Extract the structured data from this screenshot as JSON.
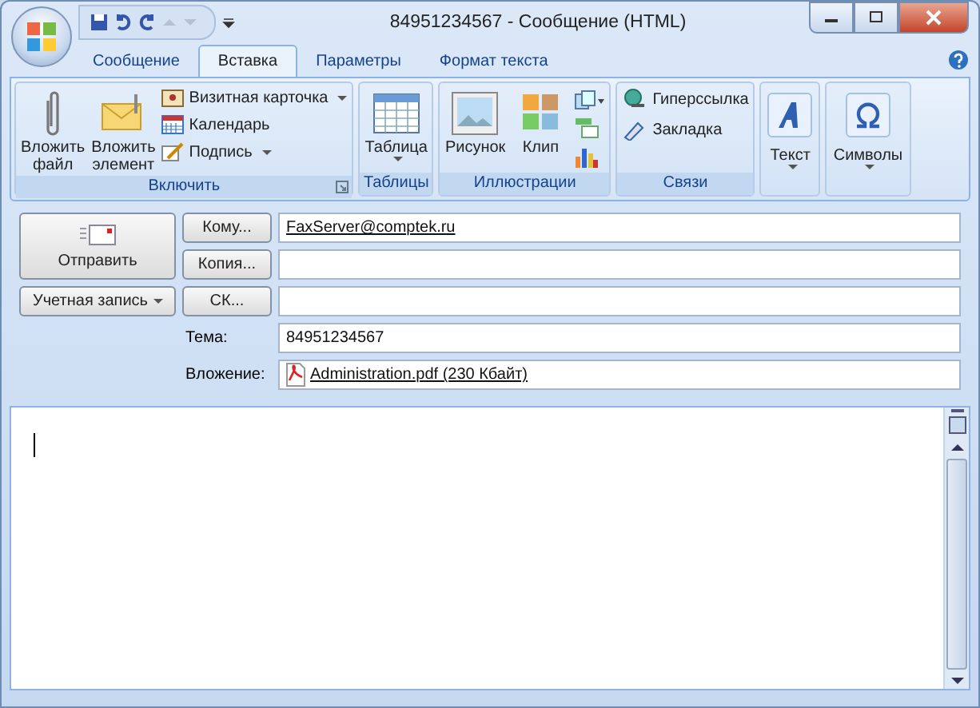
{
  "window": {
    "title": "84951234567 - Сообщение (HTML)"
  },
  "tabs": [
    {
      "label": "Сообщение",
      "selected": false
    },
    {
      "label": "Вставка",
      "selected": true
    },
    {
      "label": "Параметры",
      "selected": false
    },
    {
      "label": "Формат текста",
      "selected": false
    }
  ],
  "ribbon_groups": [
    {
      "title": "Включить",
      "launcher": true,
      "items": [
        {
          "kind": "large",
          "label": "Вложить файл"
        },
        {
          "kind": "large",
          "label": "Вложить элемент"
        },
        {
          "kind": "stack",
          "items": [
            {
              "label": "Визитная карточка",
              "dropdown": true
            },
            {
              "label": "Календарь"
            },
            {
              "label": "Подпись",
              "dropdown": true
            }
          ]
        }
      ]
    },
    {
      "title": "Таблицы",
      "items": [
        {
          "kind": "large",
          "label": "Таблица",
          "dropdown": true
        }
      ]
    },
    {
      "title": "Иллюстрации",
      "items": [
        {
          "kind": "large",
          "label": "Рисунок"
        },
        {
          "kind": "large",
          "label": "Клип"
        },
        {
          "kind": "iconstack"
        }
      ]
    },
    {
      "title": "Связи",
      "items": [
        {
          "kind": "stack",
          "items": [
            {
              "label": "Гиперссылка"
            },
            {
              "label": "Закладка"
            }
          ]
        }
      ]
    },
    {
      "items": [
        {
          "kind": "boxed",
          "label": "Текст",
          "dropdown": true
        }
      ]
    },
    {
      "items": [
        {
          "kind": "boxed",
          "label": "Символы",
          "dropdown": true
        }
      ]
    }
  ],
  "form": {
    "send_button": "Отправить",
    "account_button": {
      "label": "Учетная запись",
      "dropdown": true
    },
    "address_rows": [
      {
        "button": "Кому...",
        "value": "FaxServer@comptek.ru"
      },
      {
        "button": "Копия..."
      },
      {
        "button": "СК..."
      }
    ],
    "subject": {
      "label": "Тема:",
      "value": "84951234567"
    },
    "attachment": {
      "label": "Вложение:",
      "file": "Administration.pdf (230 Кбайт)"
    }
  }
}
